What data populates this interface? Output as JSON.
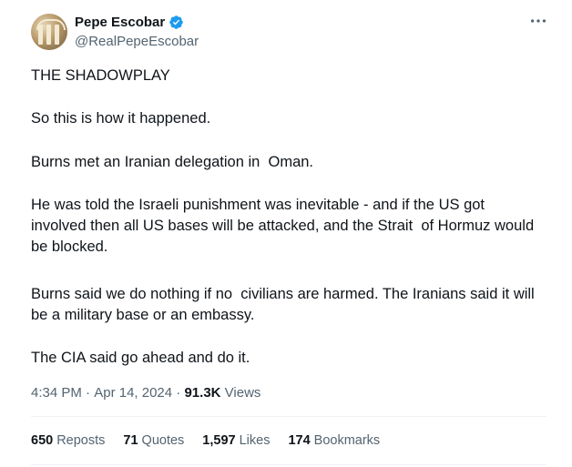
{
  "author": {
    "display_name": "Pepe Escobar",
    "handle": "@RealPepeEscobar",
    "verified": true,
    "verified_color": "#1d9bf0"
  },
  "tweet": {
    "paragraphs": [
      "THE SHADOWPLAY",
      "So this is how it happened.",
      "Burns met an Iranian delegation in  Oman.",
      "He was told the Israeli punishment was inevitable - and if the US got involved then all US bases will be attacked, and the Strait  of Hormuz would be blocked.",
      "Burns said we do nothing if no  civilians are harmed. The Iranians said it will be a military base or an embassy.",
      "The CIA said go ahead and do it."
    ]
  },
  "meta": {
    "time": "4:34 PM",
    "separator": " · ",
    "date": "Apr 14, 2024",
    "views_count": "91.3K",
    "views_label": " Views"
  },
  "stats": [
    {
      "count": "650",
      "label": "Reposts"
    },
    {
      "count": "71",
      "label": "Quotes"
    },
    {
      "count": "1,597",
      "label": "Likes"
    },
    {
      "count": "174",
      "label": "Bookmarks"
    }
  ],
  "icons": {
    "more": "more-options-icon",
    "verified": "verified-badge-icon"
  }
}
